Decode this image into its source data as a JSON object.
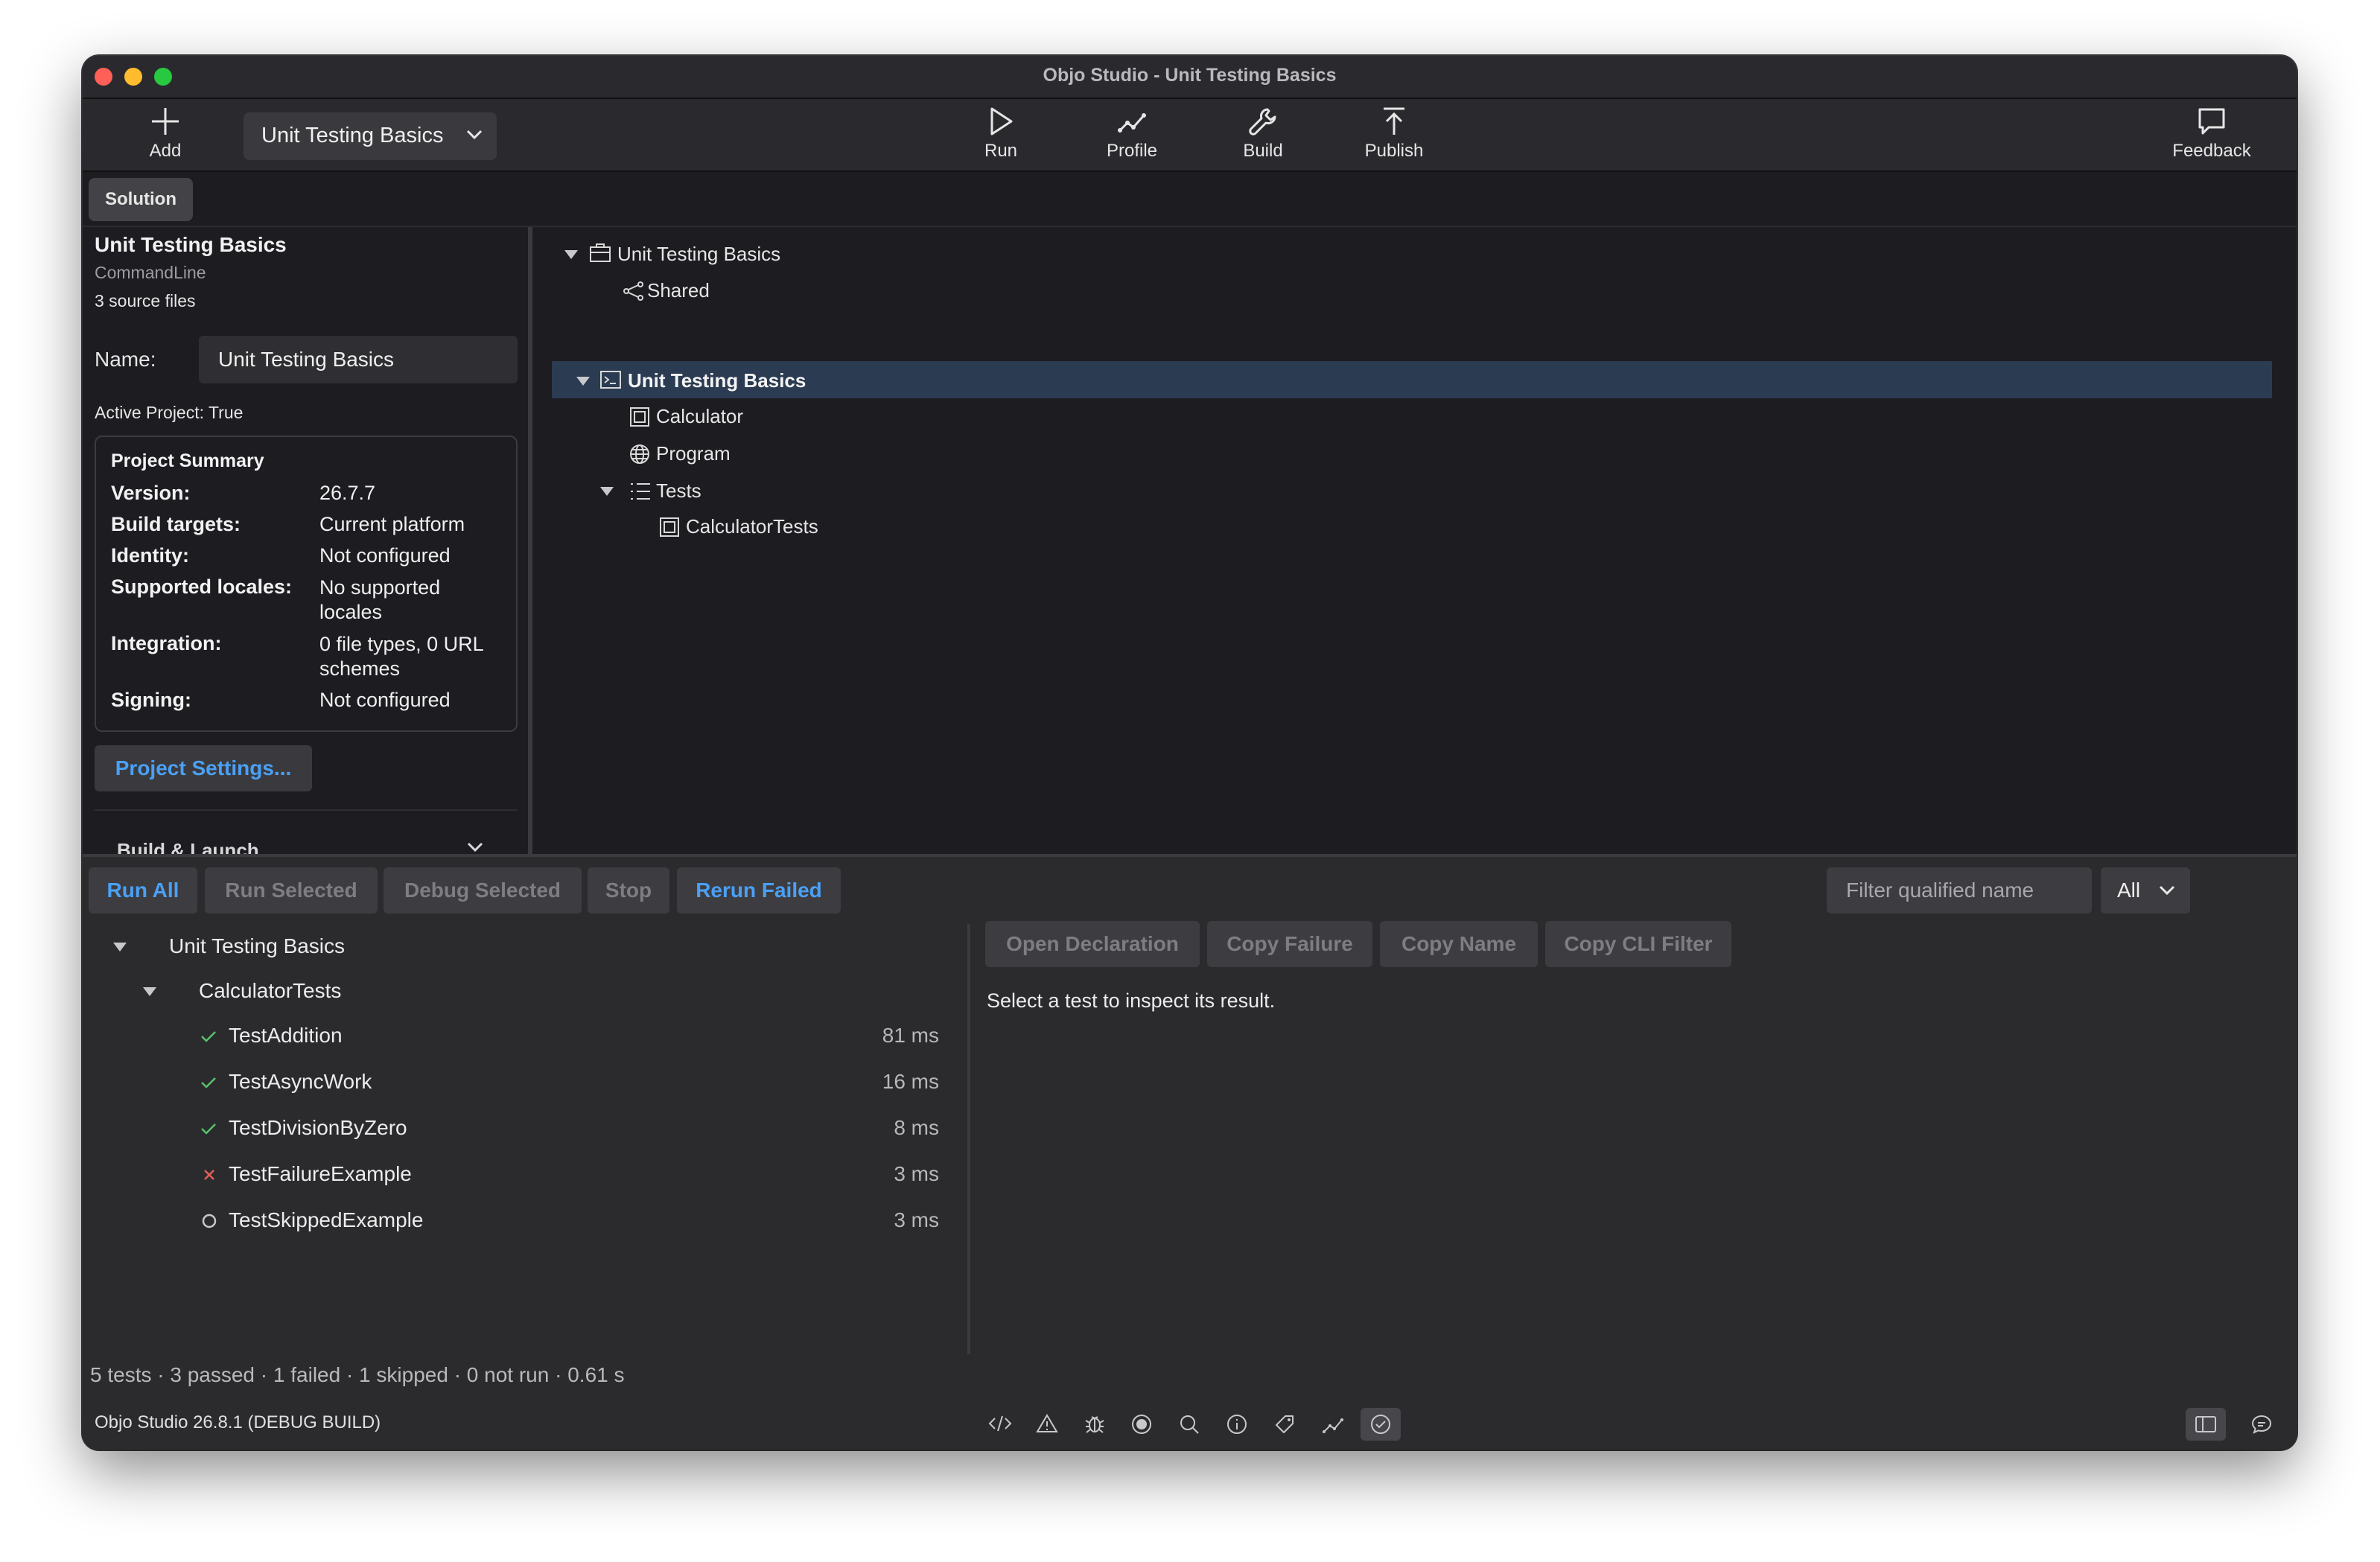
{
  "window": {
    "title": "Objo Studio - Unit Testing Basics"
  },
  "toolbar": {
    "add": "Add",
    "scheme": "Unit Testing Basics",
    "run": "Run",
    "profile": "Profile",
    "build": "Build",
    "publish": "Publish",
    "feedback": "Feedback"
  },
  "tabs": {
    "solution": "Solution"
  },
  "inspector": {
    "project_name": "Unit Testing Basics",
    "project_type": "CommandLine",
    "source_files": "3 source files",
    "name_label": "Name:",
    "name_value": "Unit Testing Basics",
    "active_project": "Active Project: True",
    "summary": {
      "title": "Project Summary",
      "rows": [
        {
          "label": "Version:",
          "value": "26.7.7"
        },
        {
          "label": "Build targets:",
          "value": "Current platform"
        },
        {
          "label": "Identity:",
          "value": "Not configured"
        },
        {
          "label": "Supported locales:",
          "value": "No supported locales"
        },
        {
          "label": "Integration:",
          "value": "0 file types, 0 URL schemes"
        },
        {
          "label": "Signing:",
          "value": "Not configured"
        }
      ]
    },
    "settings_button": "Project Settings...",
    "next_section": "Build & Launch"
  },
  "tree": {
    "items": [
      {
        "label": "Unit Testing Basics",
        "icon": "solution-icon"
      },
      {
        "label": "Shared",
        "icon": "share-icon"
      },
      {
        "label": "Unit Testing Basics",
        "icon": "terminal-icon"
      },
      {
        "label": "Calculator",
        "icon": "class-icon"
      },
      {
        "label": "Program",
        "icon": "globe-icon"
      },
      {
        "label": "Tests",
        "icon": "list-icon"
      },
      {
        "label": "CalculatorTests",
        "icon": "class-icon"
      }
    ]
  },
  "tests": {
    "buttons": {
      "run_all": "Run All",
      "run_selected": "Run Selected",
      "debug_selected": "Debug Selected",
      "stop": "Stop",
      "rerun_failed": "Rerun Failed"
    },
    "filter_placeholder": "Filter qualified name",
    "filter_mode": "All",
    "root": "Unit Testing Basics",
    "suite": "CalculatorTests",
    "cases": [
      {
        "name": "TestAddition",
        "status": "passed",
        "time": "81 ms"
      },
      {
        "name": "TestAsyncWork",
        "status": "passed",
        "time": "16 ms"
      },
      {
        "name": "TestDivisionByZero",
        "status": "passed",
        "time": "8 ms"
      },
      {
        "name": "TestFailureExample",
        "status": "failed",
        "time": "3 ms"
      },
      {
        "name": "TestSkippedExample",
        "status": "skipped",
        "time": "3 ms"
      }
    ],
    "detail_buttons": {
      "open_declaration": "Open Declaration",
      "copy_failure": "Copy Failure",
      "copy_name": "Copy Name",
      "copy_cli_filter": "Copy CLI Filter"
    },
    "detail_message": "Select a test to inspect its result.",
    "summary": "5 tests · 3 passed · 1 failed · 1 skipped · 0 not run · 0.61 s"
  },
  "status": {
    "version": "Objo Studio 26.8.1 (DEBUG BUILD)"
  },
  "colors": {
    "accent": "#4aa0f5",
    "pass": "#58c26a",
    "fail": "#e0605a",
    "selection": "#2b3b52"
  }
}
